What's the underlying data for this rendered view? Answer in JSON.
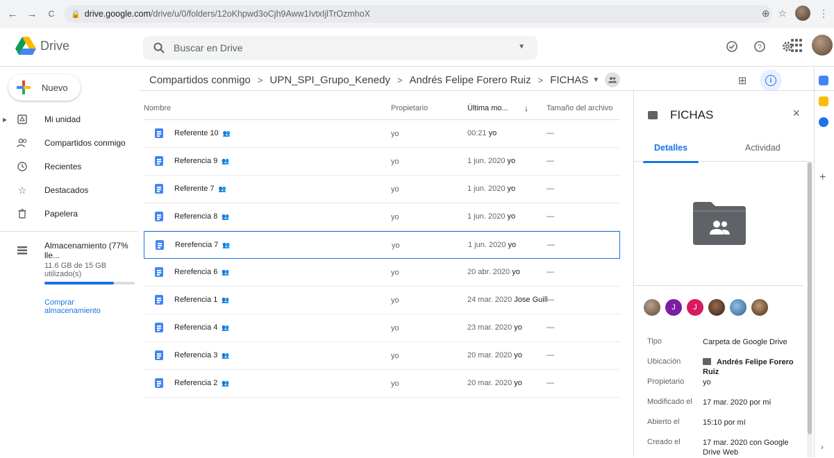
{
  "browser": {
    "back": "←",
    "forward": "→",
    "reload": "C",
    "url_host": "drive.google.com",
    "url_path": "/drive/u/0/folders/12oKhpwd3oCjh9Aww1IvtxIjlTrOzmhoX"
  },
  "header": {
    "brand": "Drive",
    "search_placeholder": "Buscar en Drive"
  },
  "sidebar": {
    "new_label": "Nuevo",
    "items": [
      {
        "label": "Mi unidad"
      },
      {
        "label": "Compartidos conmigo"
      },
      {
        "label": "Recientes"
      },
      {
        "label": "Destacados"
      },
      {
        "label": "Papelera"
      }
    ],
    "storage": {
      "label": "Almacenamiento (77% lle...",
      "usage": "11.6 GB de 15 GB utilizado(s)",
      "percent": 77,
      "buy": "Comprar almacenamiento"
    }
  },
  "breadcrumb": {
    "items": [
      "Compartidos conmigo",
      "UPN_SPI_Grupo_Kenedy",
      "Andrés Felipe Forero Ruiz",
      "FICHAS"
    ],
    "separator": ">"
  },
  "list": {
    "headers": {
      "name": "Nombre",
      "owner": "Propietario",
      "modified": "Última mo...",
      "sort_arrow": "↓",
      "size": "Tamaño del archivo"
    },
    "rows": [
      {
        "name": "Referente 10",
        "owner": "yo",
        "date": "00:21",
        "by": "yo",
        "size": "—"
      },
      {
        "name": "Referencia 9",
        "owner": "yo",
        "date": "1 jun. 2020",
        "by": "yo",
        "size": "—"
      },
      {
        "name": "Referente 7",
        "owner": "yo",
        "date": "1 jun. 2020",
        "by": "yo",
        "size": "—"
      },
      {
        "name": "Referencia 8",
        "owner": "yo",
        "date": "1 jun. 2020",
        "by": "yo",
        "size": "—"
      },
      {
        "name": "Rerefencia 7",
        "owner": "yo",
        "date": "1 jun. 2020",
        "by": "yo",
        "size": "—"
      },
      {
        "name": "Rerefencia 6",
        "owner": "yo",
        "date": "20 abr. 2020",
        "by": "yo",
        "size": "—"
      },
      {
        "name": "Referencia 1",
        "owner": "yo",
        "date": "24 mar. 2020",
        "by": "Jose Guill",
        "size": "—"
      },
      {
        "name": "Referencia 4",
        "owner": "yo",
        "date": "23 mar. 2020",
        "by": "yo",
        "size": "—"
      },
      {
        "name": "Referencia 3",
        "owner": "yo",
        "date": "20 mar. 2020",
        "by": "yo",
        "size": "—"
      },
      {
        "name": "Referencia 2",
        "owner": "yo",
        "date": "20 mar. 2020",
        "by": "yo",
        "size": "—"
      }
    ],
    "selected_row": 4
  },
  "details": {
    "title": "FICHAS",
    "close": "×",
    "tab_details": "Detalles",
    "tab_activity": "Actividad",
    "avatar_letters": [
      "J",
      "J"
    ],
    "props": [
      {
        "k": "Tipo",
        "v": "Carpeta de Google Drive"
      },
      {
        "k": "Ubicación",
        "v": "Andrés Felipe Forero Ruiz"
      },
      {
        "k": "Propietario",
        "v": "yo"
      },
      {
        "k": "Modificado el",
        "v": "17 mar. 2020 por mí"
      },
      {
        "k": "Abierto el",
        "v": "15:10 por mí"
      },
      {
        "k": "Creado el",
        "v": "17 mar. 2020 con Google Drive Web"
      }
    ]
  },
  "colors": {
    "accent": "#1a73e8",
    "doc_blue": "#4285f4",
    "avatar_purple": "#7b1fa2",
    "avatar_pink": "#d81b60"
  }
}
